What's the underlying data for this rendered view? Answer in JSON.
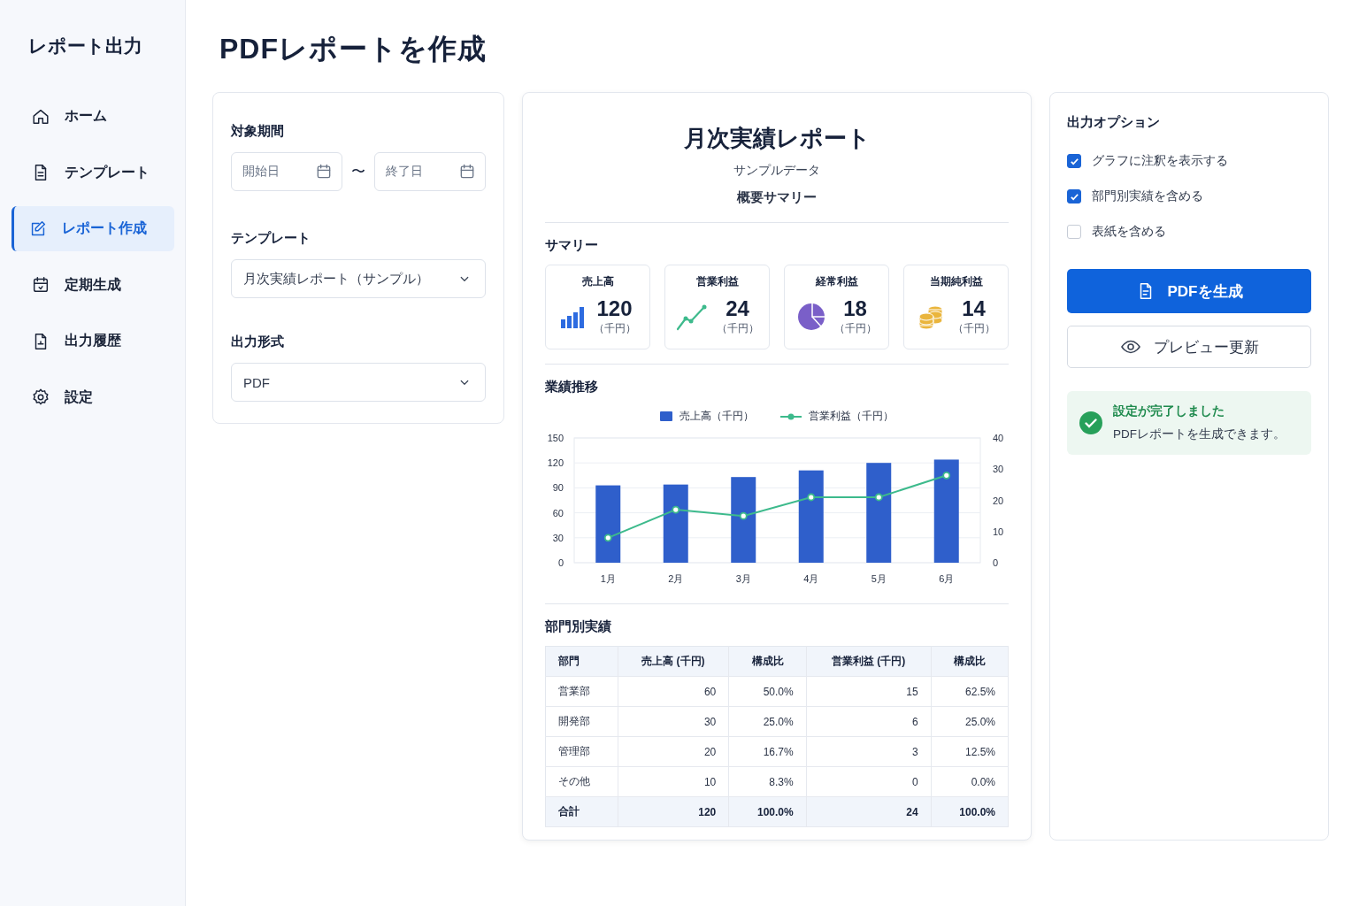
{
  "sidebar": {
    "title": "レポート出力",
    "items": [
      {
        "label": "ホーム",
        "selected": false
      },
      {
        "label": "テンプレート",
        "selected": false
      },
      {
        "label": "レポート作成",
        "selected": true
      },
      {
        "label": "定期生成",
        "selected": false
      },
      {
        "label": "出力履歴",
        "selected": false
      },
      {
        "label": "設定",
        "selected": false
      }
    ]
  },
  "page_title": "PDFレポートを作成",
  "settings": {
    "period": {
      "label": "対象期間",
      "start": {
        "placeholder": "開始日"
      },
      "separator": "〜",
      "end": {
        "placeholder": "終了日"
      }
    },
    "template": {
      "label": "テンプレート",
      "value": "月次実績レポート（サンプル）"
    },
    "format": {
      "label": "出力形式",
      "value": "PDF"
    }
  },
  "report": {
    "title": "月次実績レポート",
    "subtitle": "サンプルデータ",
    "summary_label": "概要サマリー",
    "summary": {
      "heading": "サマリー",
      "cards": [
        {
          "label": "売上高",
          "value": "120",
          "unit": "（千円）"
        },
        {
          "label": "営業利益",
          "value": "24",
          "unit": "（千円）"
        },
        {
          "label": "経常利益",
          "value": "18",
          "unit": "（千円）"
        },
        {
          "label": "当期純利益",
          "value": "14",
          "unit": "（千円）"
        }
      ]
    },
    "trend": {
      "heading": "業績推移",
      "chart_data": {
        "type": "bar",
        "categories": [
          "1月",
          "2月",
          "3月",
          "4月",
          "5月",
          "6月"
        ],
        "series": [
          {
            "name": "売上高（千円）",
            "color": "#2f5fcb",
            "values": [
              93,
              94,
              103,
              111,
              120,
              124
            ]
          },
          {
            "name": "営業利益（千円）",
            "type": "line",
            "axis": "y2",
            "marker": "circle",
            "color": "#3dba8c",
            "values": [
              8,
              17,
              15,
              21,
              21,
              28
            ]
          }
        ],
        "grid": true,
        "legend": "top",
        "ylim": [
          0,
          150
        ],
        "yticks": [
          0,
          30,
          60,
          90,
          120,
          150
        ],
        "y2lim": [
          0,
          40
        ],
        "y2ticks": [
          0,
          10,
          20,
          30,
          40
        ]
      }
    },
    "departments": {
      "heading": "部門別実績",
      "columns": [
        "部門",
        "売上高 (千円)",
        "構成比",
        "営業利益 (千円)",
        "構成比"
      ],
      "rows": [
        [
          "営業部",
          "60",
          "50.0%",
          "15",
          "62.5%"
        ],
        [
          "開発部",
          "30",
          "25.0%",
          "6",
          "25.0%"
        ],
        [
          "管理部",
          "20",
          "16.7%",
          "3",
          "12.5%"
        ],
        [
          "その他",
          "10",
          "8.3%",
          "0",
          "0.0%"
        ]
      ],
      "total": [
        "合計",
        "120",
        "100.0%",
        "24",
        "100.0%"
      ]
    }
  },
  "options": {
    "heading": "出力オプション",
    "items": [
      {
        "label": "グラフに注釈を表示する",
        "checked": true
      },
      {
        "label": "部門別実績を含める",
        "checked": true
      },
      {
        "label": "表紙を含める",
        "checked": false
      }
    ]
  },
  "buttons": [
    {
      "label": "PDFを生成",
      "kind": "primary"
    },
    {
      "label": "プレビュー更新",
      "kind": "secondary"
    }
  ],
  "notice": {
    "title": "設定が完了しました",
    "message": "PDFレポートを生成できます。"
  }
}
